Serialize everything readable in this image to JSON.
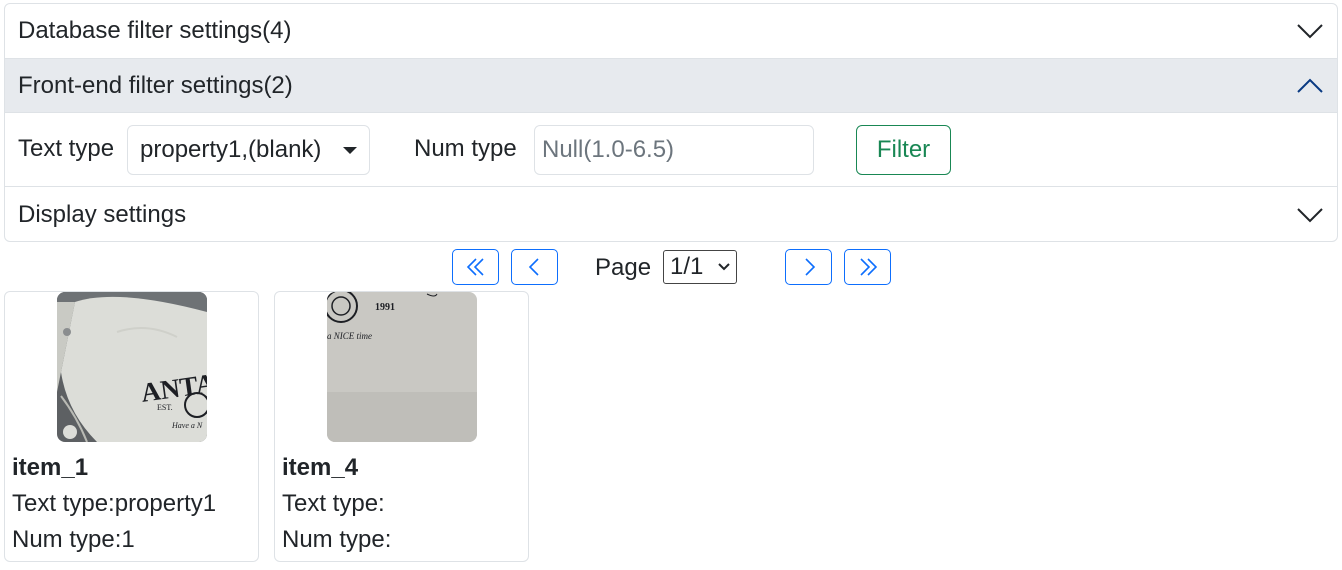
{
  "accordion": {
    "database_filter": {
      "title": "Database filter settings(4)",
      "expanded": false
    },
    "frontend_filter": {
      "title": "Front-end filter settings(2)",
      "expanded": true,
      "text_type_label": "Text type",
      "text_type_value": "property1,(blank)",
      "num_type_label": "Num type",
      "num_type_placeholder": "Null(1.0-6.5)",
      "filter_button": "Filter"
    },
    "display_settings": {
      "title": "Display settings",
      "expanded": false
    }
  },
  "pager": {
    "label": "Page",
    "selected": "1/1",
    "first_icon": "double-chevron-left-icon",
    "prev_icon": "chevron-left-icon",
    "next_icon": "chevron-right-icon",
    "last_icon": "double-chevron-right-icon"
  },
  "items": [
    {
      "title": "item_1",
      "text_type": "Text type:property1",
      "num_type": "Num type:1",
      "thumbnail": "t-shirt-photo",
      "thumbnail_print": "ANTA SPORTS"
    },
    {
      "title": "item_4",
      "text_type": "Text type:",
      "num_type": "Num type:",
      "thumbnail": "t-shirt-photo",
      "thumbnail_print": "1991"
    }
  ],
  "colors": {
    "accent_blue": "#0d6efd",
    "success_green": "#198754",
    "active_header_bg": "#e7eaee",
    "border": "#dee2e6"
  }
}
